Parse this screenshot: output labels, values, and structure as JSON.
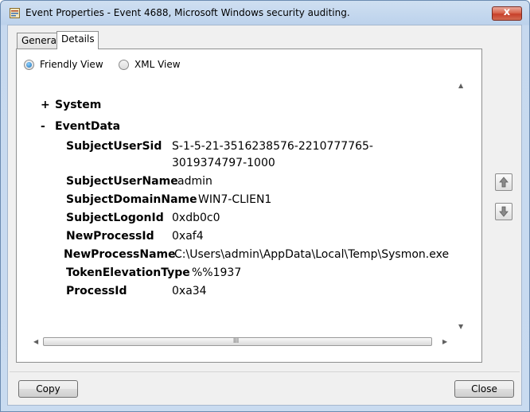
{
  "window": {
    "title": "Event Properties - Event 4688, Microsoft Windows security auditing.",
    "close_glyph": "x"
  },
  "tabs": [
    {
      "label": "General",
      "active": false
    },
    {
      "label": "Details",
      "active": true
    }
  ],
  "view_options": [
    {
      "label": "Friendly View",
      "selected": true
    },
    {
      "label": "XML View",
      "selected": false
    }
  ],
  "event_tree": {
    "system": {
      "sign": "+",
      "label": "System"
    },
    "event_data": {
      "sign": "-",
      "label": "EventData",
      "fields": [
        {
          "name": "SubjectUserSid",
          "value_line1": "S-1-5-21-3516238576-2210777765-",
          "value_line2": "3019374797-1000"
        },
        {
          "name": "SubjectUserName",
          "value": "admin"
        },
        {
          "name": "SubjectDomainName",
          "value": "WIN7-CLIEN1"
        },
        {
          "name": "SubjectLogonId",
          "value": "0xdb0c0"
        },
        {
          "name": "NewProcessId",
          "value": "0xaf4"
        },
        {
          "name": "NewProcessName",
          "value": "C:\\Users\\admin\\AppData\\Local\\Temp\\Sysmon.exe"
        },
        {
          "name": "TokenElevationType",
          "value": "%%1937"
        },
        {
          "name": "ProcessId",
          "value": "0xa34"
        }
      ]
    }
  },
  "scrollbar": {
    "grip": "III"
  },
  "buttons": {
    "copy": "Copy",
    "close": "Close"
  }
}
